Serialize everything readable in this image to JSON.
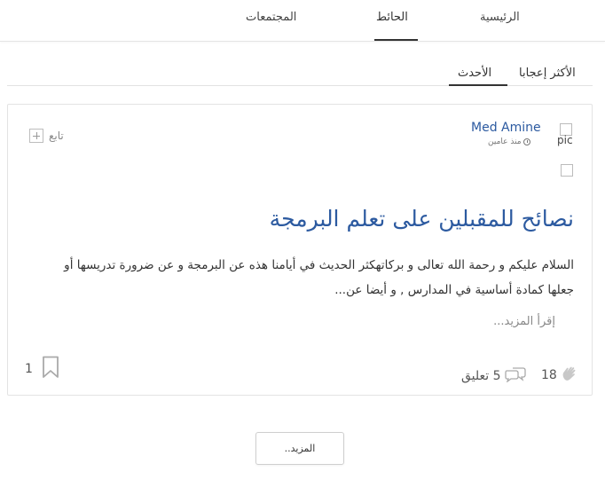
{
  "nav": {
    "items": [
      {
        "label": "الرئيسية"
      },
      {
        "label": "الحائط"
      },
      {
        "label": "المجتمعات"
      }
    ],
    "active": "الحائط"
  },
  "sort": {
    "tabs": [
      {
        "label": "الأكثر إعجابا"
      },
      {
        "label": "الأحدث"
      }
    ],
    "active": "الأحدث"
  },
  "post": {
    "avatar_alt": "pic",
    "author": "Med Amine",
    "time": "منذ عامين",
    "follow_label": "تابع",
    "title": "نصائح للمقبلين على تعلم البرمجة",
    "excerpt": "السلام عليكم و رحمة الله تعالى و بركاتهكثر الحديث في أيامنا هذه عن البرمجة و عن ضرورة تدريسها أو جعلها كمادة أساسية في المدارس , و أيضا عن...",
    "read_more": "إقرأ المزيد...",
    "likes": "18",
    "comments": "5 تعليق",
    "bookmarks": "1"
  },
  "load_more_label": "المزيد..",
  "colors": {
    "link_blue": "#2c5aa0",
    "muted": "#888888",
    "border": "#e3e3e3",
    "icon_gray": "#bbbbbb"
  },
  "icons": {
    "time": "clock-icon",
    "follow": "plus-square-icon",
    "likes": "clap-icon",
    "comments": "chat-bubbles-icon",
    "bookmark": "bookmark-icon"
  }
}
